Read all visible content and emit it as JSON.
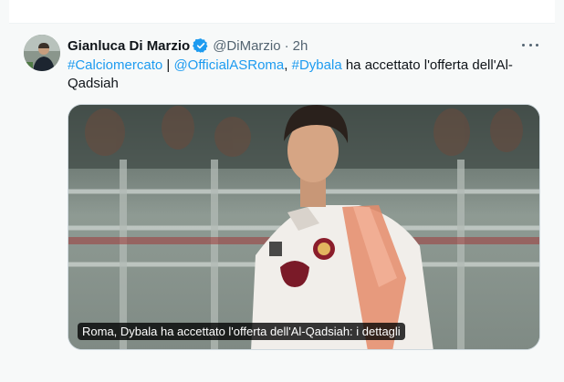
{
  "tweet": {
    "author_name": "Gianluca Di Marzio",
    "author_handle": "@DiMarzio",
    "separator": "·",
    "time": "2h",
    "text_parts": {
      "hashtag1": "#Calciomercato",
      "pipe": " | ",
      "mention": "@OfficialASRoma",
      "comma": ", ",
      "hashtag2": "#Dybala",
      "rest": " ha accettato l'offerta dell'Al-Qadsiah"
    },
    "media_caption": "Roma, Dybala ha accettato l'offerta dell'Al-Qadsiah: i dettagli"
  },
  "icons": {
    "verified": "verified-badge-icon",
    "more": "more-options-icon"
  },
  "colors": {
    "link": "#1d9bf0",
    "verified": "#1d9bf0",
    "muted_text": "#536471",
    "background": "#f7f9f9"
  }
}
